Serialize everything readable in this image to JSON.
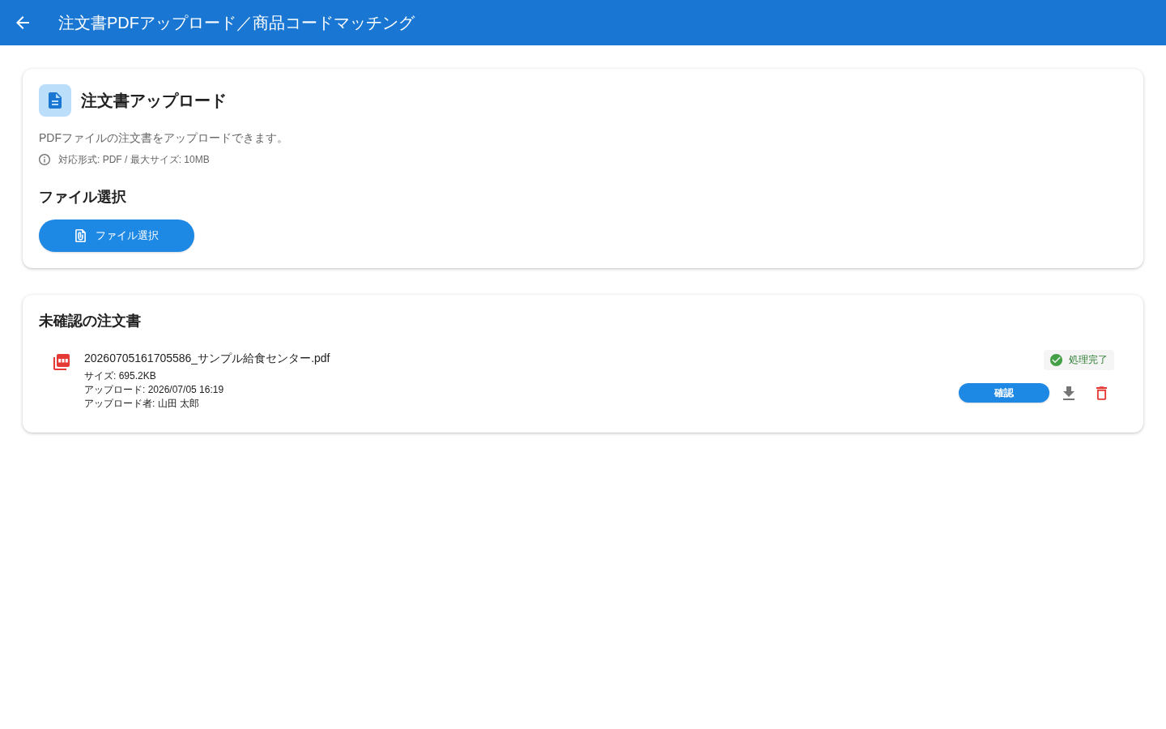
{
  "app_bar": {
    "title": "注文書PDFアップロード／商品コードマッチング"
  },
  "upload_card": {
    "title": "注文書アップロード",
    "description": "PDFファイルの注文書をアップロードできます。",
    "info": "対応形式: PDF / 最大サイズ: 10MB",
    "section_title": "ファイル選択",
    "button": "ファイル選択"
  },
  "pending_card": {
    "title": "未確認の注文書",
    "files": [
      {
        "name": "20260705161705586_サンプル給食センター.pdf",
        "details": [
          "サイズ: 695.2KB",
          "アップロード: 2026/07/05 16:19",
          "アップロード者: 山田 太郎"
        ],
        "status": {
          "label": "処理完了",
          "kind": "done"
        },
        "confirm_button": "確認"
      }
    ]
  }
}
